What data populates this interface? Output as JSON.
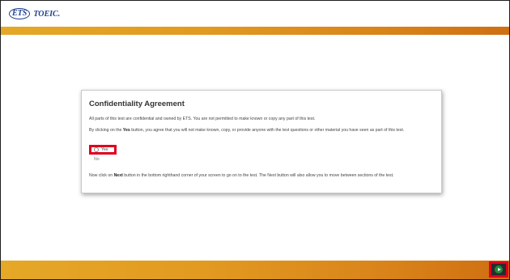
{
  "header": {
    "logo_ets": "ETS",
    "logo_text": "TOEIC."
  },
  "dialog": {
    "title": "Confidentiality Agreement",
    "paragraph1": "All parts of this test are confidential and owned by ETS. You are not permitted to make known or copy any part of this test.",
    "paragraph2_prefix": "By clicking on the ",
    "paragraph2_bold": "Yes",
    "paragraph2_suffix": " button, you agree that you will not make known, copy, or provide anyone with the test questions or other material you have seen as part of this test.",
    "yes_label": "Yes",
    "no_label": "No",
    "paragraph3_prefix": "Now click on ",
    "paragraph3_bold": "Next",
    "paragraph3_suffix": " button in the bottom righthand corner of your screen to go on to the test. The Next button will also allow you to move between sections of the test."
  },
  "footer": {
    "next_icon": "next-arrow-icon"
  },
  "colors": {
    "accent_orange": "#e29a20",
    "highlight_red": "#e0001b",
    "logo_blue": "#1d3f8f",
    "next_green": "#1f8a3a"
  }
}
